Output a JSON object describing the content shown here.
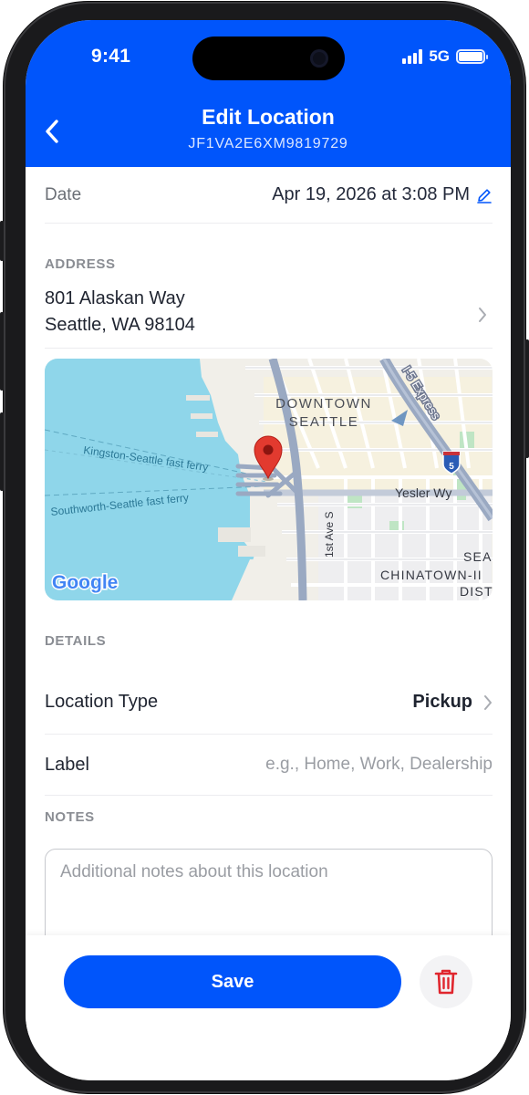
{
  "status_bar": {
    "time": "9:41",
    "network": "5G"
  },
  "nav": {
    "title": "Edit Location",
    "subtitle": "JF1VA2E6XM9819729"
  },
  "date_row": {
    "label": "Date",
    "value": "Apr 19, 2026 at 3:08 PM"
  },
  "address": {
    "section_label": "ADDRESS",
    "line1": "801 Alaskan Way",
    "line2": "Seattle, WA 98104"
  },
  "map": {
    "labels": {
      "downtown_1": "DOWNTOWN",
      "downtown_2": "SEATTLE",
      "freeway": "I-5 Express",
      "interstate_shield": "5",
      "ferry1": "Kingston-Seattle fast ferry",
      "ferry2": "Southworth-Seattle fast ferry",
      "yesler": "Yesler Wy",
      "first_ave": "1st Ave S",
      "chinatown": "CHINATOWN-II",
      "dist": "DIST",
      "sea": "SEA",
      "google": "Google"
    }
  },
  "details": {
    "section_label": "DETAILS",
    "location_type_label": "Location Type",
    "location_type_value": "Pickup",
    "label_label": "Label",
    "label_placeholder": "e.g., Home, Work, Dealership"
  },
  "notes": {
    "section_label": "NOTES",
    "placeholder": "Additional notes about this location"
  },
  "actions": {
    "save_label": "Save"
  },
  "colors": {
    "primary": "#0055fb",
    "delete": "#e0262e",
    "map_water": "#8fd6ea",
    "pin": "#e23a2f"
  }
}
